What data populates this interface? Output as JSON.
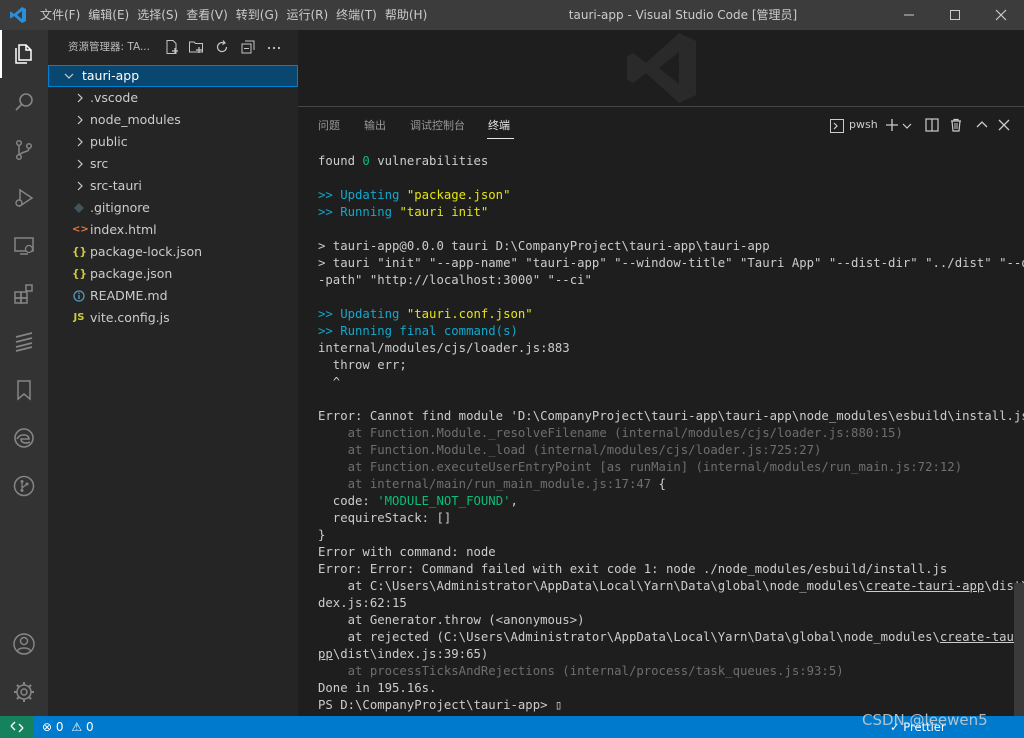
{
  "titlebar": {
    "menus": [
      "文件(F)",
      "编辑(E)",
      "选择(S)",
      "查看(V)",
      "转到(G)",
      "运行(R)",
      "终端(T)",
      "帮助(H)"
    ],
    "title": "tauri-app - Visual Studio Code [管理员]"
  },
  "sidebar": {
    "title": "资源管理器: TA...",
    "root": "tauri-app",
    "folders": [
      ".vscode",
      "node_modules",
      "public",
      "src",
      "src-tauri"
    ],
    "files": [
      {
        "name": ".gitignore",
        "icon": "gitignore-icon"
      },
      {
        "name": "index.html",
        "icon": "html-icon"
      },
      {
        "name": "package-lock.json",
        "icon": "json-icon"
      },
      {
        "name": "package.json",
        "icon": "json-icon"
      },
      {
        "name": "README.md",
        "icon": "info-icon"
      },
      {
        "name": "vite.config.js",
        "icon": "js-icon"
      }
    ]
  },
  "panel": {
    "tabs": [
      "问题",
      "输出",
      "调试控制台",
      "终端"
    ],
    "active_tab": "终端",
    "shell": "pwsh",
    "terminal_lines": [
      [
        {
          "t": "found "
        },
        {
          "t": "0",
          "c": "c-green"
        },
        {
          "t": " vulnerabilities"
        }
      ],
      [],
      [
        {
          "t": ">> Updating ",
          "c": "c-cyan"
        },
        {
          "t": "\"package.json\"",
          "c": "c-yellow"
        }
      ],
      [
        {
          "t": ">> Running ",
          "c": "c-cyan"
        },
        {
          "t": "\"tauri init\"",
          "c": "c-yellow"
        }
      ],
      [],
      [
        {
          "t": "> tauri-app@0.0.0 tauri D:\\CompanyProject\\tauri-app\\tauri-app"
        }
      ],
      [
        {
          "t": "> tauri \"init\" \"--app-name\" \"tauri-app\" \"--window-title\" \"Tauri App\" \"--dist-dir\" \"../dist\" \"--dev"
        }
      ],
      [
        {
          "t": "-path\" \"http://localhost:3000\" \"--ci\""
        }
      ],
      [],
      [
        {
          "t": ">> Updating ",
          "c": "c-cyan"
        },
        {
          "t": "\"tauri.conf.json\"",
          "c": "c-yellow"
        }
      ],
      [
        {
          "t": ">> Running final command(s)",
          "c": "c-cyan"
        }
      ],
      [
        {
          "t": "internal/modules/cjs/loader.js:883"
        }
      ],
      [
        {
          "t": "  throw err;"
        }
      ],
      [
        {
          "t": "  ^"
        }
      ],
      [],
      [
        {
          "t": "Error: Cannot find module 'D:\\CompanyProject\\tauri-app\\tauri-app\\node_modules\\esbuild\\install.js'"
        }
      ],
      [
        {
          "t": "    at Function.Module._resolveFilename (internal/modules/cjs/loader.js:880:15)",
          "c": "c-grey"
        }
      ],
      [
        {
          "t": "    at Function.Module._load (internal/modules/cjs/loader.js:725:27)",
          "c": "c-grey"
        }
      ],
      [
        {
          "t": "    at Function.executeUserEntryPoint [as runMain] (internal/modules/run_main.js:72:12)",
          "c": "c-grey"
        }
      ],
      [
        {
          "t": "    at internal/main/run_main_module.js:17:47",
          "c": "c-grey"
        },
        {
          "t": " {"
        }
      ],
      [
        {
          "t": "  code: "
        },
        {
          "t": "'MODULE_NOT_FOUND'",
          "c": "c-green"
        },
        {
          "t": ","
        }
      ],
      [
        {
          "t": "  requireStack: []"
        }
      ],
      [
        {
          "t": "}"
        }
      ],
      [
        {
          "t": "Error with command: node"
        }
      ],
      [
        {
          "t": "Error: Error: Command failed with exit code 1: node ./node_modules/esbuild/install.js"
        }
      ],
      [
        {
          "t": "    at C:\\Users\\Administrator\\AppData\\Local\\Yarn\\Data\\global\\node_modules\\"
        },
        {
          "t": "create-tauri-app",
          "c": "u"
        },
        {
          "t": "\\dist\\in"
        }
      ],
      [
        {
          "t": "dex.js:62:15"
        }
      ],
      [
        {
          "t": "    at Generator.throw (<anonymous>)"
        }
      ],
      [
        {
          "t": "    at rejected (C:\\Users\\Administrator\\AppData\\Local\\Yarn\\Data\\global\\node_modules\\"
        },
        {
          "t": "create-tauri-a",
          "c": "u"
        }
      ],
      [
        {
          "t": "pp",
          "c": "u"
        },
        {
          "t": "\\dist\\index.js:39:65)"
        }
      ],
      [
        {
          "t": "    at processTicksAndRejections (internal/process/task_queues.js:93:5)",
          "c": "c-grey"
        }
      ],
      [
        {
          "t": "Done in 195.16s."
        }
      ],
      [
        {
          "t": "PS D:\\CompanyProject\\tauri-app> "
        },
        {
          "t": "▯"
        }
      ]
    ]
  },
  "statusbar": {
    "errors": "0",
    "warnings": "0",
    "prettier": "Prettier"
  },
  "watermark": "CSDN @leewen5"
}
